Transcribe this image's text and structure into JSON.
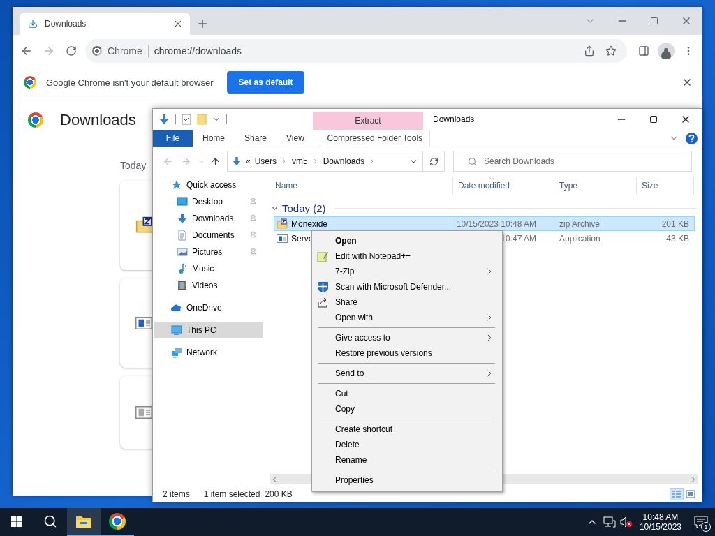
{
  "chrome": {
    "tab": {
      "title": "Downloads",
      "selected": true
    },
    "nav": {
      "back_disabled": false,
      "forward_disabled": true
    },
    "omnibox": {
      "chip": "Chrome",
      "url": "chrome://downloads"
    },
    "infobar": {
      "message": "Google Chrome isn't your default browser",
      "button": "Set as default"
    },
    "page": {
      "title": "Downloads",
      "section": "Today",
      "cards": [
        {
          "kind": "zip"
        },
        {
          "kind": "exe"
        },
        {
          "kind": "cancelled"
        }
      ]
    }
  },
  "explorer": {
    "context_header": "Extract",
    "title": "Downloads",
    "tabs": [
      {
        "label": "File",
        "kind": "file",
        "selected": false
      },
      {
        "label": "Home",
        "kind": "tab",
        "selected": false
      },
      {
        "label": "Share",
        "kind": "tab",
        "selected": false
      },
      {
        "label": "View",
        "kind": "tab",
        "selected": false
      },
      {
        "label": "Compressed Folder Tools",
        "kind": "context",
        "selected": false
      }
    ],
    "address": {
      "overflow": "«",
      "crumbs": [
        "Users",
        "vm5",
        "Downloads"
      ]
    },
    "search": {
      "placeholder": "Search Downloads"
    },
    "nav": [
      {
        "label": "Quick access",
        "kind": "quick",
        "selected": false,
        "children": [
          {
            "label": "Desktop",
            "kind": "desktop",
            "pinned": true,
            "selected": false
          },
          {
            "label": "Downloads",
            "kind": "downloads",
            "pinned": true,
            "selected": false
          },
          {
            "label": "Documents",
            "kind": "documents",
            "pinned": true,
            "selected": false
          },
          {
            "label": "Pictures",
            "kind": "pictures",
            "pinned": true,
            "selected": false
          },
          {
            "label": "Music",
            "kind": "music",
            "pinned": false,
            "selected": false
          },
          {
            "label": "Videos",
            "kind": "videos",
            "pinned": false,
            "selected": false
          }
        ]
      },
      {
        "label": "OneDrive",
        "kind": "onedrive",
        "selected": false
      },
      {
        "label": "This PC",
        "kind": "pc",
        "selected": true
      },
      {
        "label": "Network",
        "kind": "network",
        "selected": false
      }
    ],
    "columns": [
      {
        "label": "Name",
        "sorted": false
      },
      {
        "label": "Date modified",
        "sorted": true
      },
      {
        "label": "Type",
        "sorted": false
      },
      {
        "label": "Size",
        "sorted": false
      }
    ],
    "group": {
      "label": "Today (2)",
      "expanded": true
    },
    "rows": [
      {
        "name": "Monexide",
        "date": "10/15/2023 10:48 AM",
        "type": "zip Archive",
        "size": "201 KB",
        "kind": "zip",
        "selected": true
      },
      {
        "name": "Serve",
        "date": "10:47 AM",
        "type": "Application",
        "size": "43 KB",
        "kind": "exe",
        "selected": false
      }
    ],
    "status": {
      "count": "2 items",
      "selection": "1 item selected",
      "size": "200 KB"
    },
    "views": [
      {
        "kind": "details",
        "selected": true
      },
      {
        "kind": "tiles",
        "selected": false
      }
    ]
  },
  "context_menu": [
    {
      "kind": "item",
      "label": "Open",
      "default": true,
      "submenu": false
    },
    {
      "kind": "item",
      "label": "Edit with Notepad++",
      "default": false,
      "submenu": false
    },
    {
      "kind": "item",
      "label": "7-Zip",
      "default": false,
      "submenu": true
    },
    {
      "kind": "item",
      "label": "Scan with Microsoft Defender...",
      "default": false,
      "submenu": false
    },
    {
      "kind": "item",
      "label": "Share",
      "default": false,
      "submenu": false
    },
    {
      "kind": "item",
      "label": "Open with",
      "default": false,
      "submenu": true
    },
    {
      "kind": "separator"
    },
    {
      "kind": "item",
      "label": "Give access to",
      "default": false,
      "submenu": true
    },
    {
      "kind": "item",
      "label": "Restore previous versions",
      "default": false,
      "submenu": false
    },
    {
      "kind": "separator"
    },
    {
      "kind": "item",
      "label": "Send to",
      "default": false,
      "submenu": true
    },
    {
      "kind": "separator"
    },
    {
      "kind": "item",
      "label": "Cut",
      "default": false,
      "submenu": false
    },
    {
      "kind": "item",
      "label": "Copy",
      "default": false,
      "submenu": false
    },
    {
      "kind": "separator"
    },
    {
      "kind": "item",
      "label": "Create shortcut",
      "default": false,
      "submenu": false
    },
    {
      "kind": "item",
      "label": "Delete",
      "default": false,
      "submenu": false
    },
    {
      "kind": "item",
      "label": "Rename",
      "default": false,
      "submenu": false
    },
    {
      "kind": "separator"
    },
    {
      "kind": "item",
      "label": "Properties",
      "default": false,
      "submenu": false
    }
  ],
  "taskbar": {
    "apps": [
      {
        "kind": "explorer",
        "active": true
      },
      {
        "kind": "chrome",
        "active": false
      }
    ],
    "time": "10:48 AM",
    "date": "10/15/2023",
    "notifications": "1"
  }
}
